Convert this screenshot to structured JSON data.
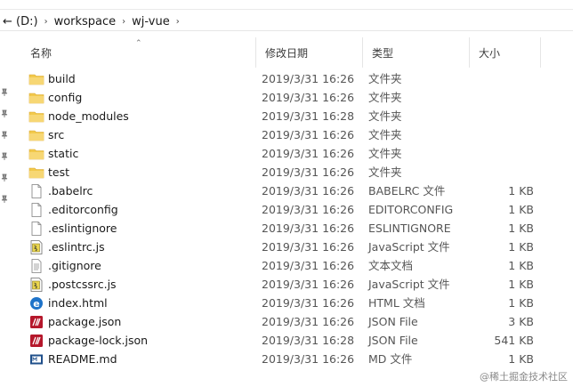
{
  "address": {
    "drive": "← (D:)",
    "crumbs": [
      "workspace",
      "wj-vue"
    ]
  },
  "columns": {
    "name": "名称",
    "date": "修改日期",
    "type": "类型",
    "size": "大小"
  },
  "files": [
    {
      "name": "build",
      "date": "2019/3/31 16:26",
      "type": "文件夹",
      "size": "",
      "icon": "folder-icon"
    },
    {
      "name": "config",
      "date": "2019/3/31 16:26",
      "type": "文件夹",
      "size": "",
      "icon": "folder-icon"
    },
    {
      "name": "node_modules",
      "date": "2019/3/31 16:28",
      "type": "文件夹",
      "size": "",
      "icon": "folder-icon"
    },
    {
      "name": "src",
      "date": "2019/3/31 16:26",
      "type": "文件夹",
      "size": "",
      "icon": "folder-icon"
    },
    {
      "name": "static",
      "date": "2019/3/31 16:26",
      "type": "文件夹",
      "size": "",
      "icon": "folder-icon"
    },
    {
      "name": "test",
      "date": "2019/3/31 16:26",
      "type": "文件夹",
      "size": "",
      "icon": "folder-icon"
    },
    {
      "name": ".babelrc",
      "date": "2019/3/31 16:26",
      "type": "BABELRC 文件",
      "size": "1 KB",
      "icon": "blank-file-icon"
    },
    {
      "name": ".editorconfig",
      "date": "2019/3/31 16:26",
      "type": "EDITORCONFIG",
      "size": "1 KB",
      "icon": "blank-file-icon"
    },
    {
      "name": ".eslintignore",
      "date": "2019/3/31 16:26",
      "type": "ESLINTIGNORE",
      "size": "1 KB",
      "icon": "blank-file-icon"
    },
    {
      "name": ".eslintrc.js",
      "date": "2019/3/31 16:26",
      "type": "JavaScript 文件",
      "size": "1 KB",
      "icon": "js-file-icon"
    },
    {
      "name": ".gitignore",
      "date": "2019/3/31 16:26",
      "type": "文本文档",
      "size": "1 KB",
      "icon": "text-file-icon"
    },
    {
      "name": ".postcssrc.js",
      "date": "2019/3/31 16:26",
      "type": "JavaScript 文件",
      "size": "1 KB",
      "icon": "js-file-icon"
    },
    {
      "name": "index.html",
      "date": "2019/3/31 16:26",
      "type": "HTML 文档",
      "size": "1 KB",
      "icon": "html-file-icon"
    },
    {
      "name": "package.json",
      "date": "2019/3/31 16:26",
      "type": "JSON File",
      "size": "3 KB",
      "icon": "json-file-icon"
    },
    {
      "name": "package-lock.json",
      "date": "2019/3/31 16:28",
      "type": "JSON File",
      "size": "541 KB",
      "icon": "json-file-icon"
    },
    {
      "name": "README.md",
      "date": "2019/3/31 16:26",
      "type": "MD 文件",
      "size": "1 KB",
      "icon": "md-file-icon"
    }
  ],
  "watermark": "@稀土掘金技术社区",
  "colors": {
    "folder": "#f2c94c",
    "json": "#b5172b",
    "html": "#1e73c9"
  }
}
